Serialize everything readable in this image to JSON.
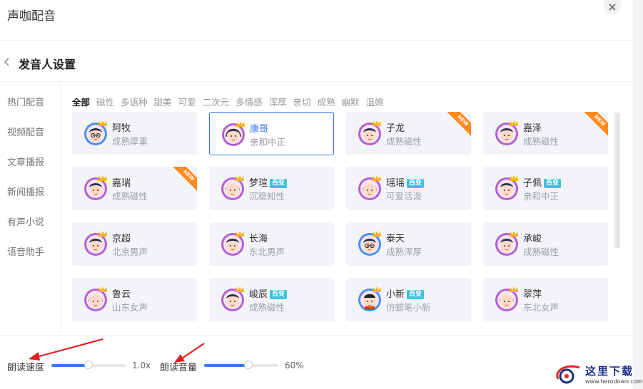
{
  "header": {
    "app_title": "声咖配音"
  },
  "section": {
    "title": "发音人设置"
  },
  "sidebar": {
    "items": [
      {
        "label": "热门配音",
        "active": true
      },
      {
        "label": "视频配音",
        "active": false
      },
      {
        "label": "文章播报",
        "active": false
      },
      {
        "label": "新闻播报",
        "active": false
      },
      {
        "label": "有声小说",
        "active": false
      },
      {
        "label": "语音助手",
        "active": false
      }
    ]
  },
  "filters": [
    "全部",
    "磁性",
    "多语种",
    "甜美",
    "可爱",
    "二次元",
    "多情感",
    "浑厚",
    "亲切",
    "成熟",
    "幽默",
    "温婉"
  ],
  "voices": [
    {
      "name": "阿牧",
      "desc": "成熟厚重",
      "tag": "",
      "badge": "",
      "selected": false,
      "avatar": "male-glasses"
    },
    {
      "name": "康哥",
      "desc": "亲和中正",
      "tag": "",
      "badge": "",
      "selected": true,
      "avatar": "male-headset"
    },
    {
      "name": "子龙",
      "desc": "成熟磁性",
      "tag": "",
      "badge": "NEW",
      "selected": false,
      "avatar": "male"
    },
    {
      "name": "嘉泽",
      "desc": "成熟磁性",
      "tag": "",
      "badge": "NEW",
      "selected": false,
      "avatar": "male"
    },
    {
      "name": "嘉瑞",
      "desc": "成熟磁性",
      "tag": "",
      "badge": "NEW",
      "selected": false,
      "avatar": "male"
    },
    {
      "name": "梦瑄",
      "desc": "沉稳知性",
      "tag": "百变",
      "badge": "",
      "selected": false,
      "avatar": "female"
    },
    {
      "name": "瑶瑶",
      "desc": "可爱活泼",
      "tag": "百变",
      "badge": "",
      "selected": false,
      "avatar": "female"
    },
    {
      "name": "子佩",
      "desc": "亲和中正",
      "tag": "百变",
      "badge": "",
      "selected": false,
      "avatar": "male"
    },
    {
      "name": "京超",
      "desc": "北京男声",
      "tag": "",
      "badge": "",
      "selected": false,
      "avatar": "male"
    },
    {
      "name": "长海",
      "desc": "东北男声",
      "tag": "",
      "badge": "",
      "selected": false,
      "avatar": "male"
    },
    {
      "name": "泰天",
      "desc": "成熟浑厚",
      "tag": "",
      "badge": "",
      "selected": false,
      "avatar": "male-glasses"
    },
    {
      "name": "承峻",
      "desc": "成熟磁性",
      "tag": "",
      "badge": "",
      "selected": false,
      "avatar": "male"
    },
    {
      "name": "鲁云",
      "desc": "山东女声",
      "tag": "",
      "badge": "",
      "selected": false,
      "avatar": "female"
    },
    {
      "name": "峻辰",
      "desc": "成熟磁性",
      "tag": "百变",
      "badge": "",
      "selected": false,
      "avatar": "male"
    },
    {
      "name": "小新",
      "desc": "仿蜡笔小新",
      "tag": "百变",
      "badge": "",
      "selected": false,
      "avatar": "boy-cartoon"
    },
    {
      "name": "翠萍",
      "desc": "东北女声",
      "tag": "",
      "badge": "",
      "selected": false,
      "avatar": "female-pink"
    }
  ],
  "controls": {
    "speed": {
      "label": "朗读速度",
      "value": 0.5,
      "display": "1.0x"
    },
    "volume": {
      "label": "朗读音量",
      "value": 0.6,
      "display": "60%"
    }
  },
  "watermark": {
    "text": "这里下载",
    "url": "www.herodown.com"
  },
  "colors": {
    "accent": "#3a78ff",
    "ribbon": "#ff8a1e",
    "tag": "#3cc4e0",
    "annotation_arrow": "#e02020"
  }
}
